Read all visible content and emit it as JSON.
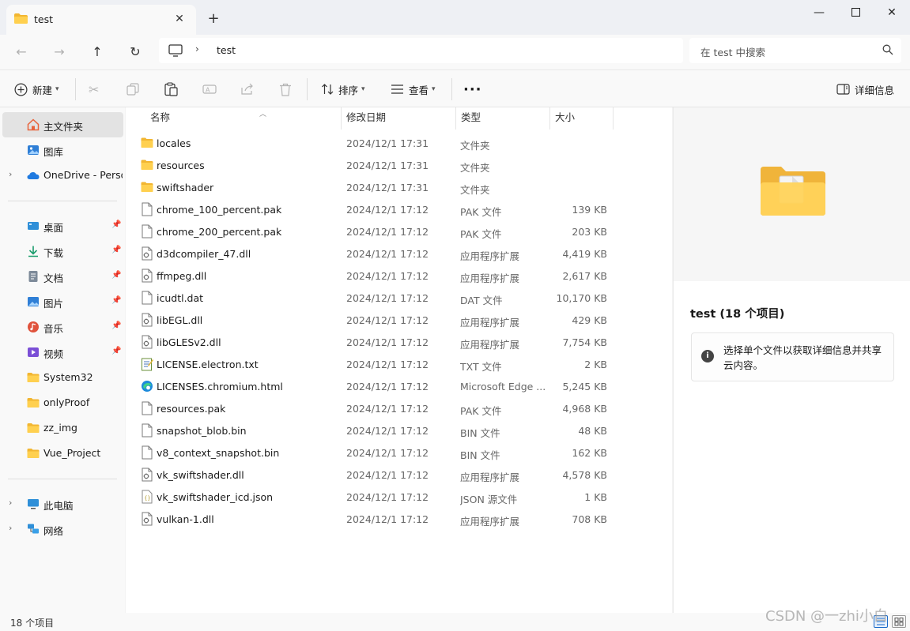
{
  "tab": {
    "title": "test"
  },
  "address": {
    "path": "test",
    "search_placeholder": "在 test 中搜索"
  },
  "toolbar": {
    "new_label": "新建",
    "sort_label": "排序",
    "view_label": "查看",
    "details_label": "详细信息"
  },
  "sidebar": {
    "home": "主文件夹",
    "gallery": "图库",
    "onedrive": "OneDrive - Perso",
    "quick": [
      {
        "label": "桌面",
        "icon": "desktop-icon",
        "color": "#2f8fd8"
      },
      {
        "label": "下载",
        "icon": "download-icon",
        "color": "#1a9c6b"
      },
      {
        "label": "文档",
        "icon": "document-icon",
        "color": "#6f7d8c"
      },
      {
        "label": "图片",
        "icon": "pictures-icon",
        "color": "#2f7fd6"
      },
      {
        "label": "音乐",
        "icon": "music-icon",
        "color": "#e0533d"
      },
      {
        "label": "视频",
        "icon": "video-icon",
        "color": "#7b4fd6"
      }
    ],
    "folders": [
      "System32",
      "onlyProof",
      "zz_img",
      "Vue_Project"
    ],
    "this_pc": "此电脑",
    "network": "网络"
  },
  "columns": {
    "name": "名称",
    "date": "修改日期",
    "type": "类型",
    "size": "大小"
  },
  "files": [
    {
      "name": "locales",
      "date": "2024/12/1 17:31",
      "type": "文件夹",
      "size": "",
      "icon": "folder-icon"
    },
    {
      "name": "resources",
      "date": "2024/12/1 17:31",
      "type": "文件夹",
      "size": "",
      "icon": "folder-icon"
    },
    {
      "name": "swiftshader",
      "date": "2024/12/1 17:31",
      "type": "文件夹",
      "size": "",
      "icon": "folder-icon"
    },
    {
      "name": "chrome_100_percent.pak",
      "date": "2024/12/1 17:12",
      "type": "PAK 文件",
      "size": "139 KB",
      "icon": "file-icon"
    },
    {
      "name": "chrome_200_percent.pak",
      "date": "2024/12/1 17:12",
      "type": "PAK 文件",
      "size": "203 KB",
      "icon": "file-icon"
    },
    {
      "name": "d3dcompiler_47.dll",
      "date": "2024/12/1 17:12",
      "type": "应用程序扩展",
      "size": "4,419 KB",
      "icon": "dll-icon"
    },
    {
      "name": "ffmpeg.dll",
      "date": "2024/12/1 17:12",
      "type": "应用程序扩展",
      "size": "2,617 KB",
      "icon": "dll-icon"
    },
    {
      "name": "icudtl.dat",
      "date": "2024/12/1 17:12",
      "type": "DAT 文件",
      "size": "10,170 KB",
      "icon": "file-icon"
    },
    {
      "name": "libEGL.dll",
      "date": "2024/12/1 17:12",
      "type": "应用程序扩展",
      "size": "429 KB",
      "icon": "dll-icon"
    },
    {
      "name": "libGLESv2.dll",
      "date": "2024/12/1 17:12",
      "type": "应用程序扩展",
      "size": "7,754 KB",
      "icon": "dll-icon"
    },
    {
      "name": "LICENSE.electron.txt",
      "date": "2024/12/1 17:12",
      "type": "TXT 文件",
      "size": "2 KB",
      "icon": "text-file-icon"
    },
    {
      "name": "LICENSES.chromium.html",
      "date": "2024/12/1 17:12",
      "type": "Microsoft Edge ...",
      "size": "5,245 KB",
      "icon": "edge-icon"
    },
    {
      "name": "resources.pak",
      "date": "2024/12/1 17:12",
      "type": "PAK 文件",
      "size": "4,968 KB",
      "icon": "file-icon"
    },
    {
      "name": "snapshot_blob.bin",
      "date": "2024/12/1 17:12",
      "type": "BIN 文件",
      "size": "48 KB",
      "icon": "file-icon"
    },
    {
      "name": "v8_context_snapshot.bin",
      "date": "2024/12/1 17:12",
      "type": "BIN 文件",
      "size": "162 KB",
      "icon": "file-icon"
    },
    {
      "name": "vk_swiftshader.dll",
      "date": "2024/12/1 17:12",
      "type": "应用程序扩展",
      "size": "4,578 KB",
      "icon": "dll-icon"
    },
    {
      "name": "vk_swiftshader_icd.json",
      "date": "2024/12/1 17:12",
      "type": "JSON 源文件",
      "size": "1 KB",
      "icon": "json-file-icon"
    },
    {
      "name": "vulkan-1.dll",
      "date": "2024/12/1 17:12",
      "type": "应用程序扩展",
      "size": "708 KB",
      "icon": "dll-icon"
    }
  ],
  "details": {
    "title": "test (18 个项目)",
    "info": "选择单个文件以获取详细信息并共享云内容。"
  },
  "status": {
    "count": "18 个项目"
  },
  "watermark": "CSDN @一zhi小白"
}
